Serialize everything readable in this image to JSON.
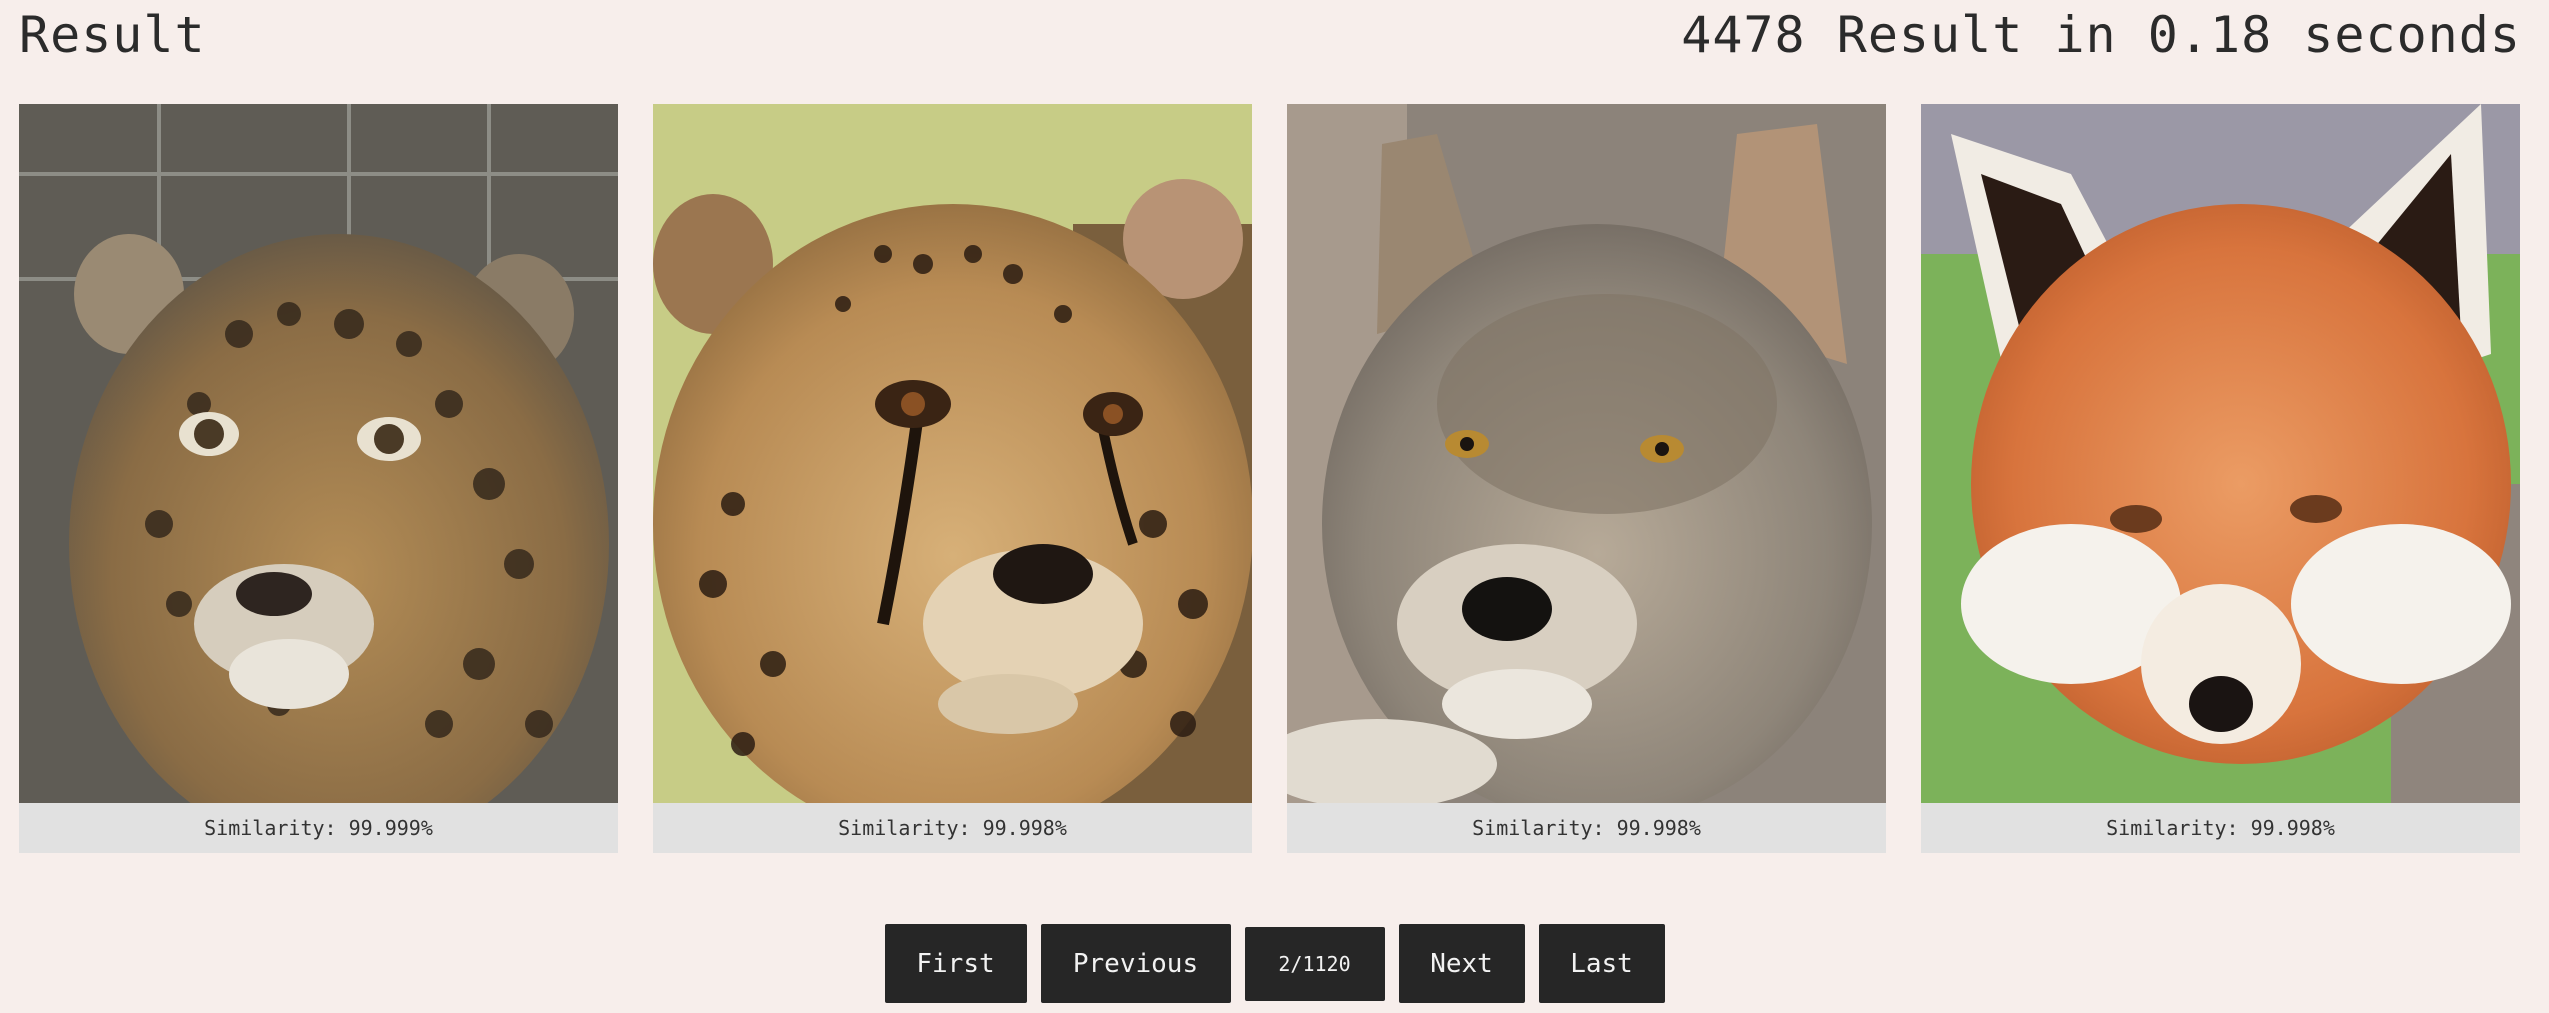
{
  "header": {
    "title": "Result",
    "summary": "4478 Result in 0.18 seconds"
  },
  "results": [
    {
      "image": "jaguar-face-photo",
      "similarity": "Similarity: 99.999%"
    },
    {
      "image": "cheetah-face-photo",
      "similarity": "Similarity: 99.998%"
    },
    {
      "image": "wolf-face-photo",
      "similarity": "Similarity: 99.998%"
    },
    {
      "image": "red-fox-face-photo",
      "similarity": "Similarity: 99.998%"
    }
  ],
  "pagination": {
    "first": "First",
    "previous": "Previous",
    "page_indicator": "2/1120",
    "next": "Next",
    "last": "Last"
  },
  "colors": {
    "background": "#f7eeeb",
    "button": "#262626",
    "caption_bg": "#e1e1e1"
  }
}
